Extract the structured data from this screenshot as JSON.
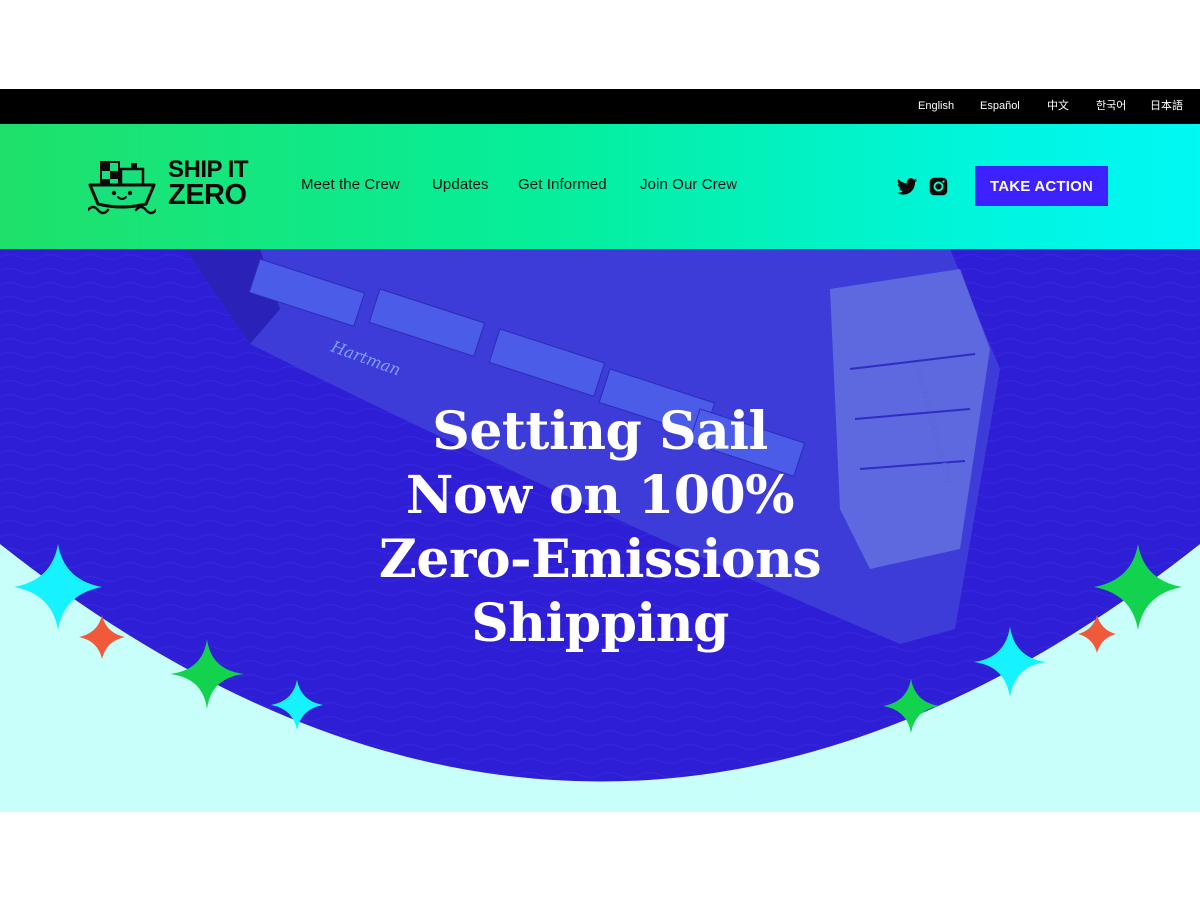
{
  "languages": [
    "English",
    "Español",
    "中文",
    "한국어",
    "日本語"
  ],
  "logo": {
    "line1": "SHIP IT",
    "line2": "ZERO",
    "icon": "ship-mascot-icon"
  },
  "nav": [
    "Meet the Crew",
    "Updates",
    "Get Informed",
    "Join Our Crew"
  ],
  "social": {
    "twitter_icon": "twitter-icon",
    "instagram_icon": "instagram-icon"
  },
  "cta": {
    "label": "TAKE ACTION"
  },
  "hero": {
    "title_lines": [
      "Setting Sail",
      "Now on 100%",
      "Zero-Emissions",
      "Shipping"
    ],
    "ship_name": "Hartman",
    "ship_side_text": "HARTMAN SEATRADE.COM"
  },
  "colors": {
    "langbar": "#000000",
    "header_gradient_start": "#1fe06a",
    "header_gradient_end": "#00f8f5",
    "cta": "#3d22ff",
    "hero_overlay": "#2e1ed6",
    "hero_floor": "#c8fffb",
    "sparkle_cyan": "#16f2ff",
    "sparkle_green": "#12d24e",
    "sparkle_red": "#f05a3a"
  }
}
